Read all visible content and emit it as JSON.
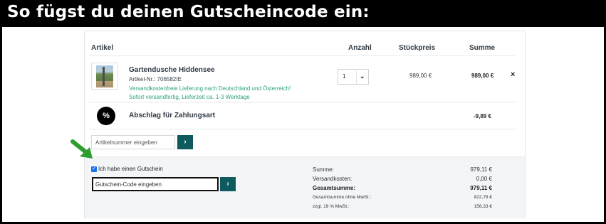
{
  "banner": {
    "title": "So fügst du deinen Gutscheincode ein:"
  },
  "table_headers": {
    "artikel": "Artikel",
    "anzahl": "Anzahl",
    "stueckpreis": "Stückpreis",
    "summe": "Summe"
  },
  "product": {
    "name": "Gartendusche Hiddensee",
    "article_nr": "Artikel-Nr.: 706582IE",
    "shipping_note": "Versandkostenfreie Lieferung nach Deutschland und Österreich!",
    "availability": "Sofort versandfertig, Lieferzeit ca. 1-3 Werktage",
    "quantity": "1",
    "unit_price": "989,00 €",
    "total": "989,00 €",
    "remove_icon": "×"
  },
  "fee": {
    "icon": "%",
    "label": "Abschlag für Zahlungsart",
    "value": "-9,89 €"
  },
  "article_input": {
    "placeholder": "Artikelnummer eingeben",
    "button_icon": "›"
  },
  "voucher": {
    "checkbox_label": "Ich habe einen Gutschein",
    "checked": true,
    "input_placeholder": "Gutschein-Code eingeben",
    "button_icon": "›"
  },
  "totals": [
    {
      "label": "Summe:",
      "value": "979,11 €"
    },
    {
      "label": "Versandkosten:",
      "value": "0,00 €"
    },
    {
      "label": "Gesamtsumme:",
      "value": "979,11 €"
    },
    {
      "label": "Gesamtsumme ohne MwSt.:",
      "value": "822,78 €"
    },
    {
      "label": "zzgl. 19 % MwSt.:",
      "value": "156,33 €"
    }
  ],
  "colors": {
    "accent": "#0e5a5f",
    "green_text": "#2fa37d",
    "arrow": "#2e9e2e"
  }
}
